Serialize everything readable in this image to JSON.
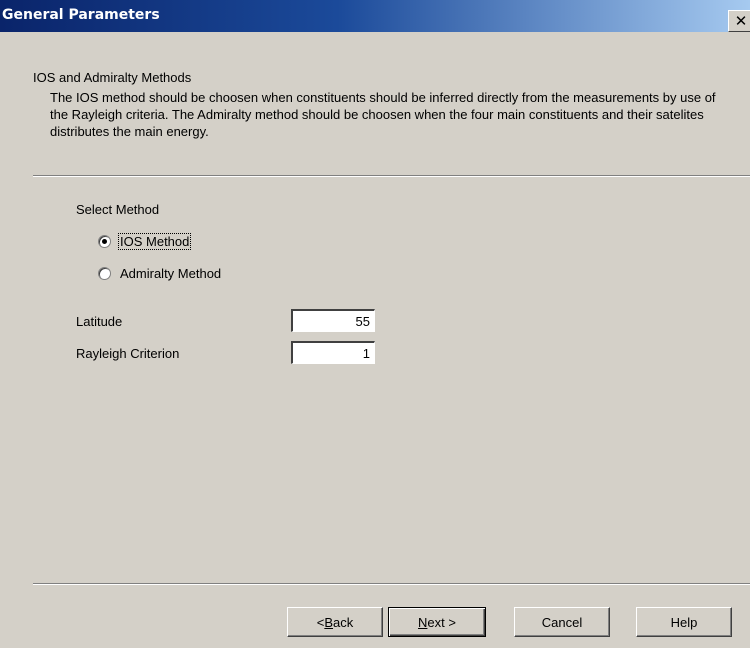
{
  "window": {
    "title": "General Parameters",
    "close_glyph": "✕"
  },
  "intro": {
    "heading": "IOS and Admiralty Methods",
    "description": "The IOS method should be choosen when constituents should be inferred directly from the measurements by use of the Rayleigh criteria. The Admiralty method should be choosen when the four main constituents and their satelites distributes the main energy."
  },
  "method": {
    "label": "Select Method",
    "options": [
      {
        "label": "IOS Method",
        "checked": true
      },
      {
        "label": "Admiralty Method",
        "checked": false
      }
    ]
  },
  "fields": {
    "latitude": {
      "label": "Latitude",
      "value": "55"
    },
    "rayleigh": {
      "label": "Rayleigh Criterion",
      "value": "1"
    }
  },
  "buttons": {
    "back": {
      "prefix": "< ",
      "mnemonic": "B",
      "rest": "ack"
    },
    "next": {
      "mnemonic": "N",
      "rest": "ext >"
    },
    "cancel": "Cancel",
    "help": "Help"
  }
}
